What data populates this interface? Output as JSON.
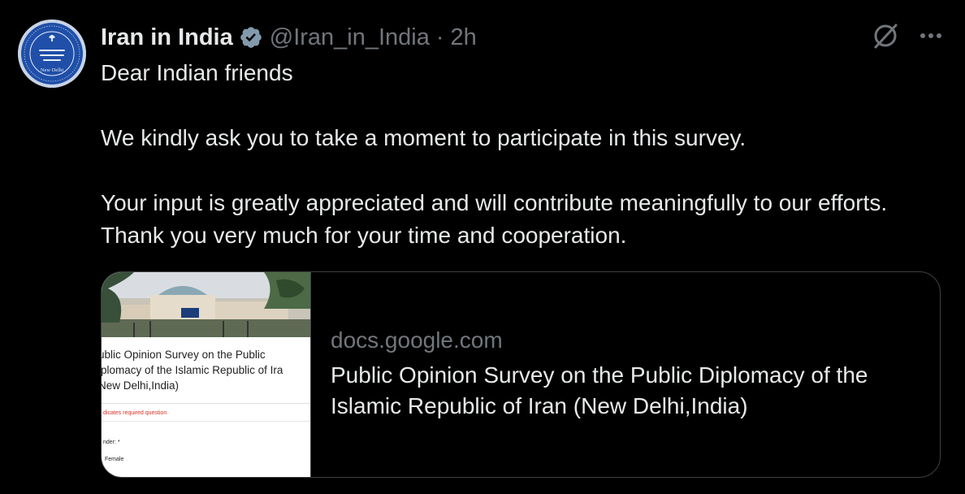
{
  "tweet": {
    "author": {
      "display_name": "Iran in India",
      "handle": "@Iran_in_India",
      "verified": true,
      "avatar_text": "New Delhi"
    },
    "separator": "·",
    "time": "2h",
    "body": {
      "p1": "Dear Indian friends",
      "p2": "We kindly ask you to take a moment to participate in this survey.",
      "p3": "Your input is greatly appreciated and will contribute meaningfully to our efforts. Thank you very much for your time and cooperation."
    },
    "icons": {
      "grok": "grok-icon",
      "more": "more-icon",
      "verified": "verified-badge-icon"
    },
    "card": {
      "domain": "docs.google.com",
      "title": "Public Opinion Survey on the Public Diplomacy of the Islamic Republic of Iran (New Delhi,India)",
      "thumbnail": {
        "form_title": "ublic Opinion Survey on the Public\niplomacy of the Islamic Republic of Ira\nNew Delhi,India)",
        "required_note": "dicates required question",
        "question": "nder: *",
        "option": "Female"
      }
    }
  },
  "colors": {
    "background": "#000000",
    "text": "#e7e9ea",
    "secondary": "#71767b",
    "verified": "#829aab",
    "border": "#3e4144"
  }
}
